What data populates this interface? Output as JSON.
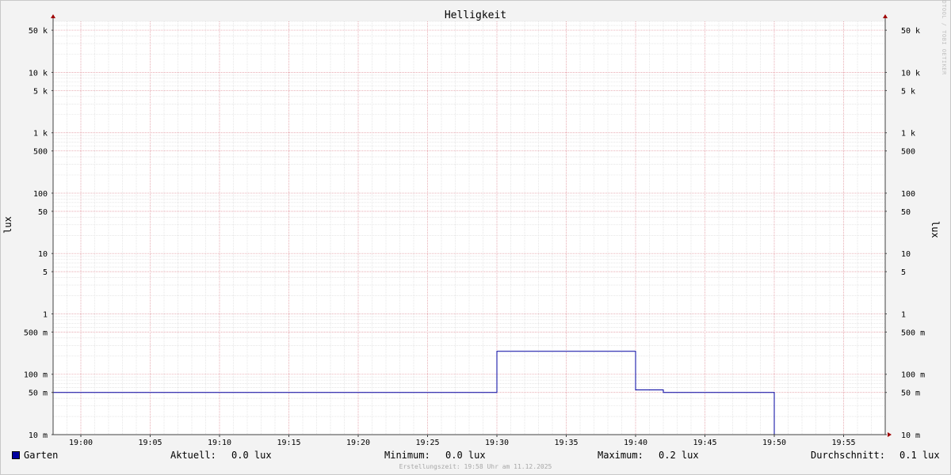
{
  "chart_data": {
    "type": "line",
    "title": "Helligkeit",
    "ylabel": "lux",
    "ylabel_right": "lux",
    "yscale": "log",
    "ylim": [
      0.01,
      70000
    ],
    "xlim": [
      "18:58",
      "19:58"
    ],
    "x_ticks": [
      "19:00",
      "19:05",
      "19:10",
      "19:15",
      "19:20",
      "19:25",
      "19:30",
      "19:35",
      "19:40",
      "19:45",
      "19:50",
      "19:55"
    ],
    "y_ticks": [
      {
        "value": 50000,
        "label": "50 k"
      },
      {
        "value": 10000,
        "label": "10 k"
      },
      {
        "value": 5000,
        "label": "5 k"
      },
      {
        "value": 1000,
        "label": "1 k"
      },
      {
        "value": 500,
        "label": "500"
      },
      {
        "value": 100,
        "label": "100"
      },
      {
        "value": 50,
        "label": "50"
      },
      {
        "value": 10,
        "label": "10"
      },
      {
        "value": 5,
        "label": "5"
      },
      {
        "value": 1,
        "label": "1"
      },
      {
        "value": 0.5,
        "label": "500 m"
      },
      {
        "value": 0.1,
        "label": "100 m"
      },
      {
        "value": 0.05,
        "label": "50 m"
      },
      {
        "value": 0.01,
        "label": "10 m"
      }
    ],
    "grid": true,
    "series": [
      {
        "name": "Garten",
        "color": "#0000a0",
        "points": [
          {
            "x": "18:58",
            "y": 0.05
          },
          {
            "x": "19:30",
            "y": 0.05
          },
          {
            "x": "19:30",
            "y": 0.24
          },
          {
            "x": "19:40",
            "y": 0.24
          },
          {
            "x": "19:40",
            "y": 0.055
          },
          {
            "x": "19:42",
            "y": 0.055
          },
          {
            "x": "19:42",
            "y": 0.05
          },
          {
            "x": "19:50",
            "y": 0.05
          },
          {
            "x": "19:50",
            "y": 0.01
          },
          {
            "x": "19:58",
            "y": 0.01
          }
        ]
      }
    ]
  },
  "legend": {
    "series_name": "Garten",
    "current_label": "Aktuell:",
    "current_value": "0.0 lux",
    "min_label": "Minimum:",
    "min_value": "0.0 lux",
    "max_label": "Maximum:",
    "max_value": "0.2 lux",
    "avg_label": "Durchschnitt:",
    "avg_value": "0.1 lux"
  },
  "watermark": "RRDTOOL / TOBI OETIKER",
  "footer": "Erstellungszeit: 19:58 Uhr am 11.12.2025",
  "colors": {
    "line": "#0000a0",
    "major_grid": "#e8a0a8",
    "minor_grid": "#d8d8d8",
    "axis": "#404040",
    "arrow": "#a00000"
  }
}
